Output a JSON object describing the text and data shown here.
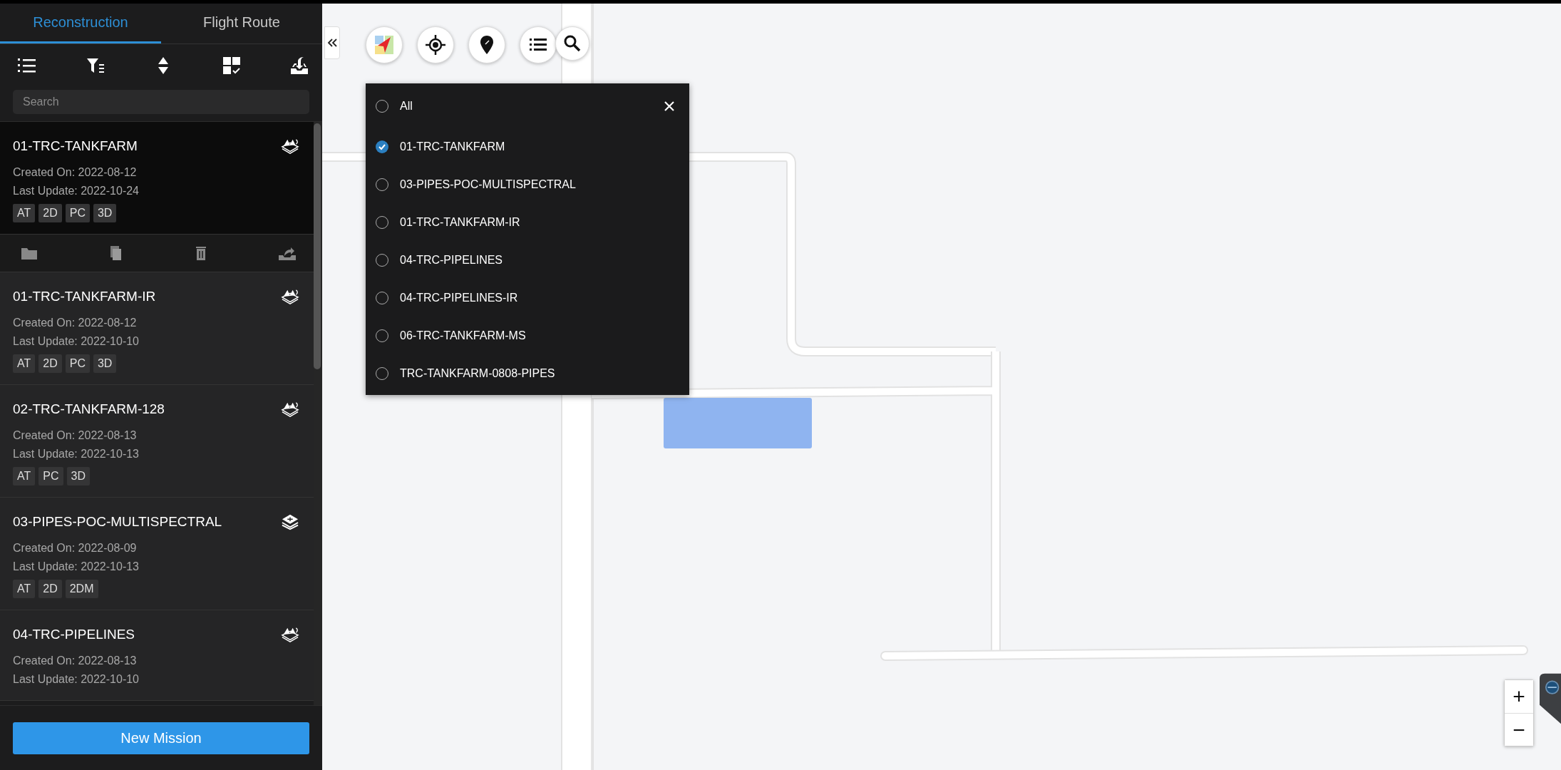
{
  "tabs": [
    {
      "label": "Reconstruction",
      "selected": true
    },
    {
      "label": "Flight Route",
      "selected": false
    }
  ],
  "search": {
    "placeholder": "Search"
  },
  "missions": [
    {
      "name": "01-TRC-TANKFARM",
      "created": "Created On: 2022-08-12",
      "updated": "Last Update: 2022-10-24",
      "tags": [
        "AT",
        "2D",
        "PC",
        "3D"
      ],
      "kind": "model",
      "selected": true
    },
    {
      "name": "01-TRC-TANKFARM-IR",
      "created": "Created On: 2022-08-12",
      "updated": "Last Update: 2022-10-10",
      "tags": [
        "AT",
        "2D",
        "PC",
        "3D"
      ],
      "kind": "model",
      "selected": false
    },
    {
      "name": "02-TRC-TANKFARM-128",
      "created": "Created On: 2022-08-13",
      "updated": "Last Update: 2022-10-13",
      "tags": [
        "AT",
        "PC",
        "3D"
      ],
      "kind": "model",
      "selected": false
    },
    {
      "name": "03-PIPES-POC-MULTISPECTRAL",
      "created": "Created On: 2022-08-09",
      "updated": "Last Update: 2022-10-13",
      "tags": [
        "AT",
        "2D",
        "2DM"
      ],
      "kind": "layers",
      "selected": false
    },
    {
      "name": "04-TRC-PIPELINES",
      "created": "Created On: 2022-08-13",
      "updated": "Last Update: 2022-10-10",
      "kind": "model",
      "selected": false
    }
  ],
  "new_mission_button": "New Mission",
  "layer_menu": {
    "options": [
      {
        "label": "All",
        "selected": false
      },
      {
        "label": "01-TRC-TANKFARM",
        "selected": true
      },
      {
        "label": "03-PIPES-POC-MULTISPECTRAL",
        "selected": false
      },
      {
        "label": "01-TRC-TANKFARM-IR",
        "selected": false
      },
      {
        "label": "04-TRC-PIPELINES",
        "selected": false
      },
      {
        "label": "04-TRC-PIPELINES-IR",
        "selected": false
      },
      {
        "label": "06-TRC-TANKFARM-MS",
        "selected": false
      },
      {
        "label": "TRC-TANKFARM-0808-PIPES",
        "selected": false
      }
    ]
  },
  "zoom_controls": [
    "+",
    "−"
  ]
}
